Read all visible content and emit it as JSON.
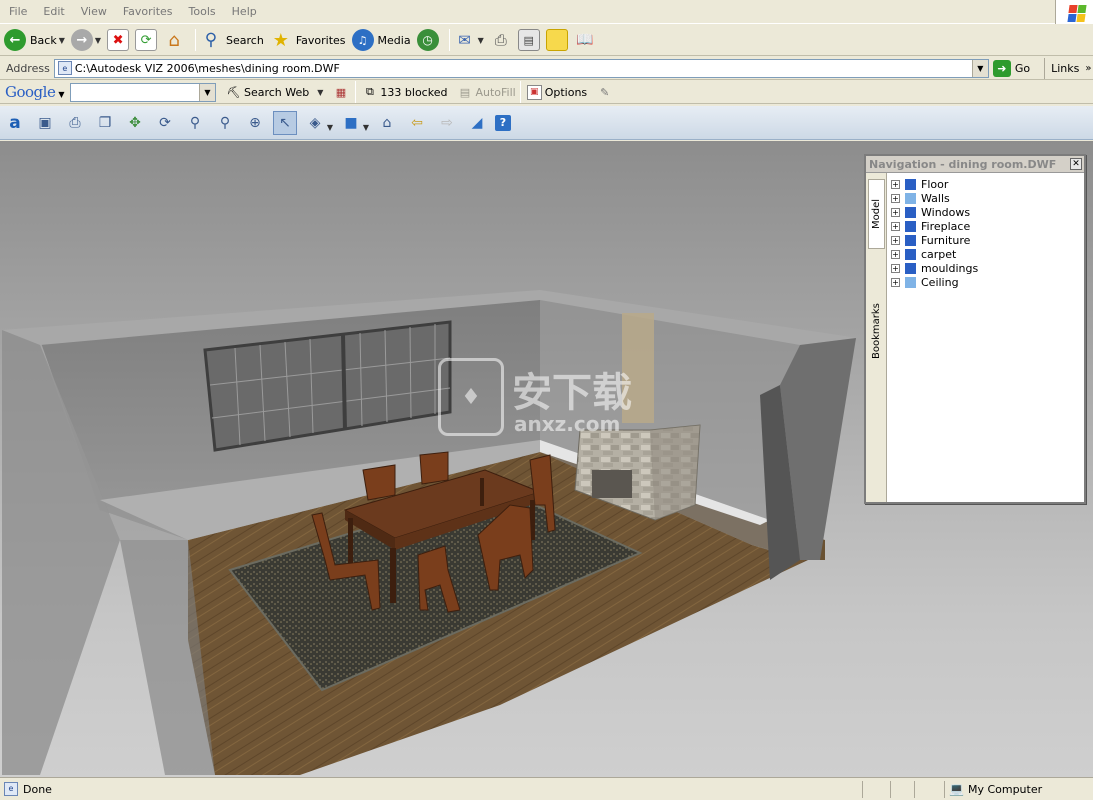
{
  "menu": [
    "File",
    "Edit",
    "View",
    "Favorites",
    "Tools",
    "Help"
  ],
  "toolbar": {
    "back_label": "Back",
    "search_label": "Search",
    "favorites_label": "Favorites",
    "media_label": "Media"
  },
  "address": {
    "label": "Address",
    "value": "C:\\Autodesk VIZ 2006\\meshes\\dining room.DWF",
    "go_label": "Go",
    "links_label": "Links"
  },
  "google": {
    "logo": "Google",
    "search_web_label": "Search Web",
    "blocked_label": "133 blocked",
    "autofill_label": "AutoFill",
    "options_label": "Options"
  },
  "navigation": {
    "title": "Navigation - dining room.DWF",
    "tab_model": "Model",
    "tab_bookmarks": "Bookmarks",
    "items": [
      {
        "label": "Floor"
      },
      {
        "label": "Walls"
      },
      {
        "label": "Windows"
      },
      {
        "label": "Fireplace"
      },
      {
        "label": "Furniture"
      },
      {
        "label": "carpet"
      },
      {
        "label": "mouldings"
      },
      {
        "label": "Ceiling"
      }
    ]
  },
  "watermark": {
    "text": "安下载",
    "sub": "anxz.com"
  },
  "status": {
    "text": "Done",
    "zone": "My Computer"
  }
}
